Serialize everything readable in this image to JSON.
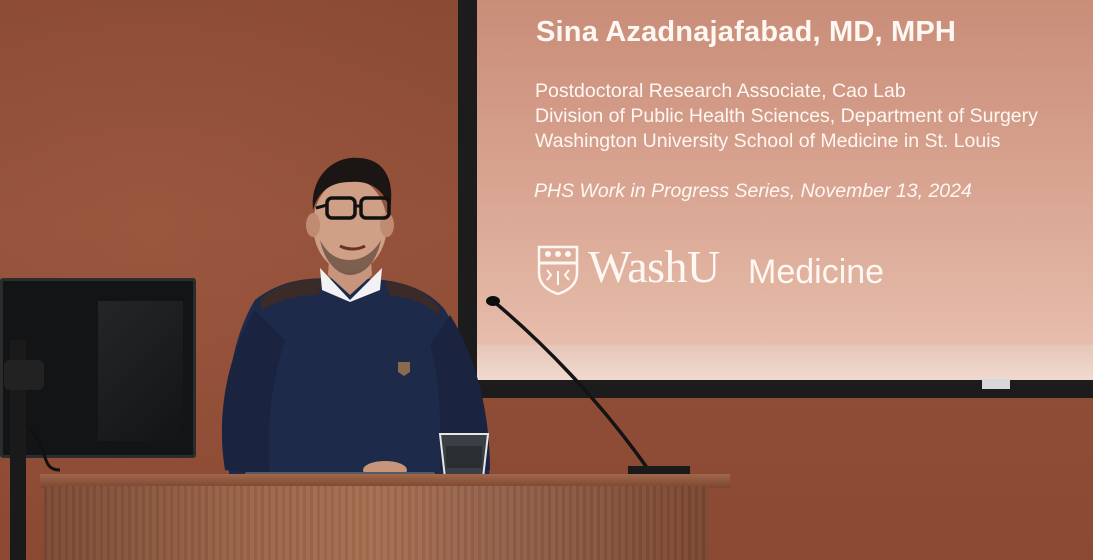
{
  "photo": {
    "description_label": "",
    "colors": {
      "wall": "#8f4e37",
      "slide": "#d7a28f",
      "sweater": "#1e2a4a",
      "podium": "#9a6447"
    }
  },
  "slide": {
    "presenter": "Sina Azadnajafabad, MD, MPH",
    "affiliations": [
      "Postdoctoral Research Associate, Cao Lab",
      "Division of Public Health Sciences, Department of Surgery",
      "Washington University School of Medicine in St. Louis"
    ],
    "series": "PHS Work in Progress Series, November 13, 2024",
    "logo": {
      "wordmark": "WashU",
      "unit": "Medicine",
      "icon": "shield-icon"
    }
  }
}
